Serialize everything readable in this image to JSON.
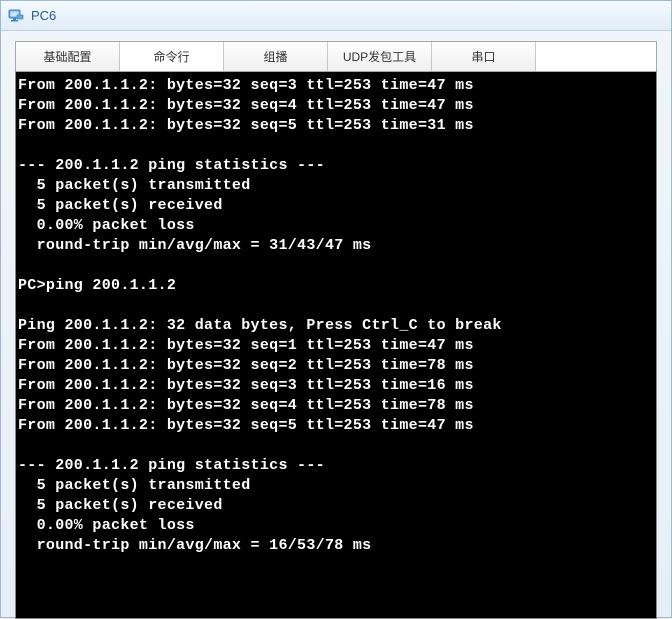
{
  "window": {
    "title": "PC6"
  },
  "tabs": [
    {
      "label": "基础配置"
    },
    {
      "label": "命令行"
    },
    {
      "label": "组播"
    },
    {
      "label": "UDP发包工具"
    },
    {
      "label": "串口"
    }
  ],
  "terminal": {
    "lines": [
      "From 200.1.1.2: bytes=32 seq=3 ttl=253 time=47 ms",
      "From 200.1.1.2: bytes=32 seq=4 ttl=253 time=47 ms",
      "From 200.1.1.2: bytes=32 seq=5 ttl=253 time=31 ms",
      "",
      "--- 200.1.1.2 ping statistics ---",
      "  5 packet(s) transmitted",
      "  5 packet(s) received",
      "  0.00% packet loss",
      "  round-trip min/avg/max = 31/43/47 ms",
      "",
      "PC>ping 200.1.1.2",
      "",
      "Ping 200.1.1.2: 32 data bytes, Press Ctrl_C to break",
      "From 200.1.1.2: bytes=32 seq=1 ttl=253 time=47 ms",
      "From 200.1.1.2: bytes=32 seq=2 ttl=253 time=78 ms",
      "From 200.1.1.2: bytes=32 seq=3 ttl=253 time=16 ms",
      "From 200.1.1.2: bytes=32 seq=4 ttl=253 time=78 ms",
      "From 200.1.1.2: bytes=32 seq=5 ttl=253 time=47 ms",
      "",
      "--- 200.1.1.2 ping statistics ---",
      "  5 packet(s) transmitted",
      "  5 packet(s) received",
      "  0.00% packet loss",
      "  round-trip min/avg/max = 16/53/78 ms",
      ""
    ]
  }
}
